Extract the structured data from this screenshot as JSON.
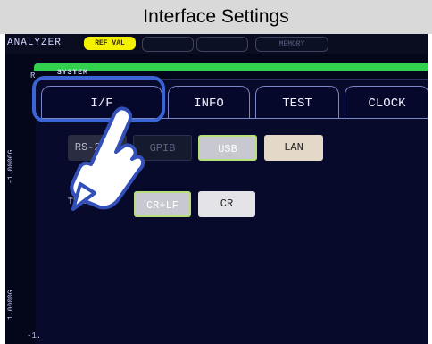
{
  "title": "Interface Settings",
  "top_bar": {
    "mode": "ANALYZER",
    "ref_val": "REF VAL",
    "memory": "MEMORY"
  },
  "section": "SYSTEM",
  "left_marker": "R",
  "tabs": [
    {
      "label": "I/F",
      "selected": true
    },
    {
      "label": "INFO"
    },
    {
      "label": "TEST"
    },
    {
      "label": "CLOCK"
    }
  ],
  "interfaces": {
    "rs232c": "RS-232C",
    "gpib": "GPIB",
    "usb": "USB",
    "lan": "LAN",
    "selected": "USB"
  },
  "term": {
    "label": "TERM",
    "options": [
      "CR+LF",
      "CR"
    ],
    "selected": "CR+LF"
  },
  "side_labels": {
    "top": "-1.0000G",
    "bottom": "1.0000G",
    "bottom_tick": "-1."
  },
  "colors": {
    "accent_highlight": "#3b64d4",
    "green_bar": "#31d14e",
    "ref_val": "#f4f200",
    "selected_border": "#b8e07a"
  },
  "icons": {
    "pointer": "hand-pointer-icon"
  }
}
